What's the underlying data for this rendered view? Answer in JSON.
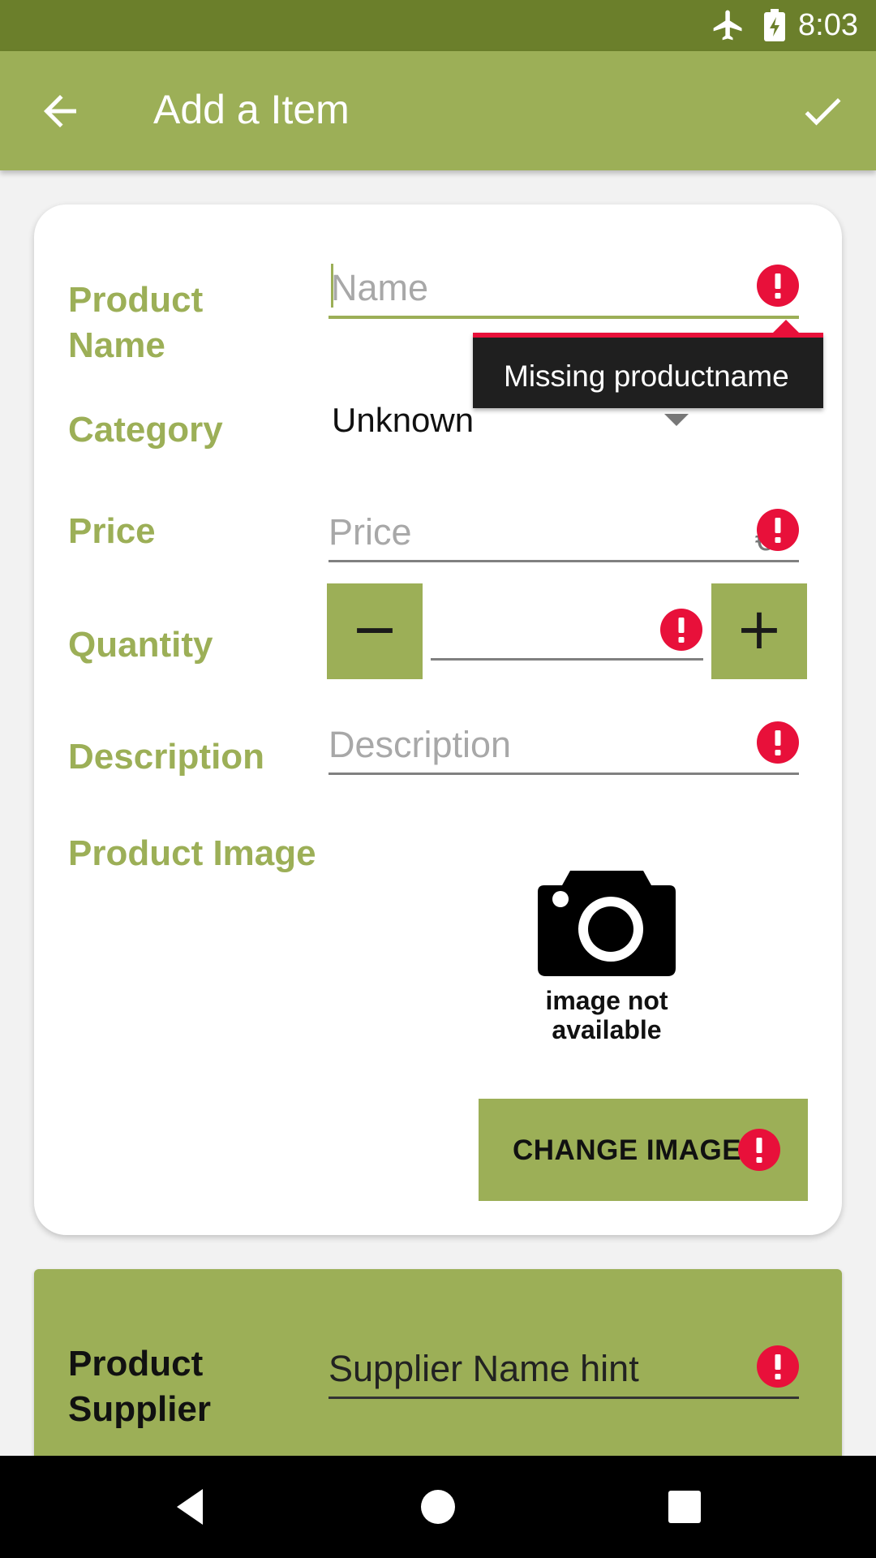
{
  "status_bar": {
    "time": "8:03",
    "icons": [
      "airplane-icon",
      "battery-charging-icon"
    ]
  },
  "app_bar": {
    "title": "Add a Item",
    "back_icon": "arrow-left-icon",
    "confirm_icon": "check-icon"
  },
  "form": {
    "product_name": {
      "label_line1": "Product",
      "label_line2": "Name",
      "placeholder": "Name",
      "error": "Missing productname"
    },
    "category": {
      "label": "Category",
      "selected": "Unknown"
    },
    "price": {
      "label": "Price",
      "placeholder": "Price",
      "currency": "€"
    },
    "quantity": {
      "label": "Quantity",
      "decrement": "−",
      "increment": "+"
    },
    "description": {
      "label": "Description",
      "placeholder": "Description"
    },
    "product_image": {
      "label": "Product Image",
      "placeholder_line1": "image not",
      "placeholder_line2": "available",
      "change_button": "CHANGE IMAGE"
    }
  },
  "supplier": {
    "label_line1": "Product",
    "label_line2": "Supplier",
    "placeholder": "Supplier Name hint"
  },
  "colors": {
    "accent": "#9caf57",
    "status_bar": "#6b7f2b",
    "error": "#e8103a",
    "tooltip_bg": "#1f1f1f"
  }
}
